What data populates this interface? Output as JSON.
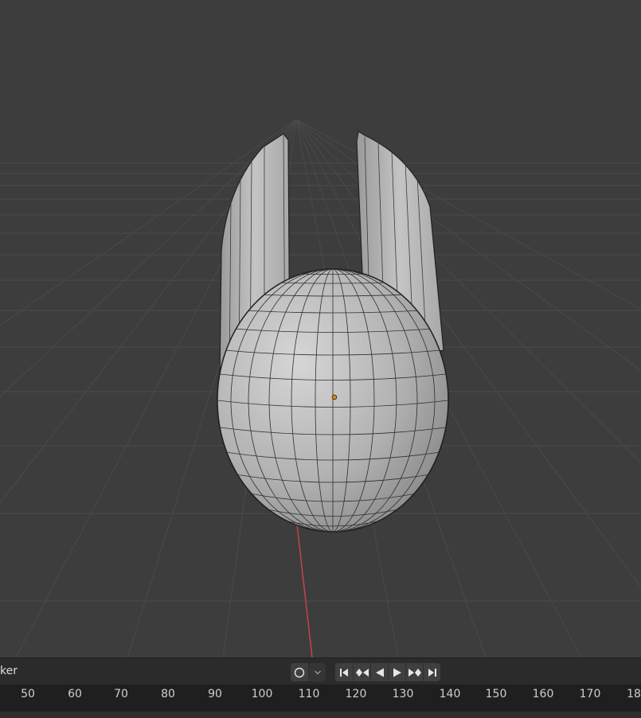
{
  "timeline": {
    "marker_label": "ker",
    "controls": [
      {
        "name": "keying-toggle",
        "icon": "circle-icon"
      },
      {
        "name": "keying-dropdown",
        "icon": "chevron-down-icon"
      },
      {
        "name": "jump-to-start",
        "icon": "jump-start-icon"
      },
      {
        "name": "prev-keyframe",
        "icon": "prev-keyframe-icon"
      },
      {
        "name": "play-reverse",
        "icon": "play-reverse-icon"
      },
      {
        "name": "play",
        "icon": "play-icon"
      },
      {
        "name": "next-keyframe",
        "icon": "next-keyframe-icon"
      },
      {
        "name": "jump-to-end",
        "icon": "jump-end-icon"
      }
    ],
    "ruler_ticks": [
      "50",
      "60",
      "70",
      "80",
      "90",
      "100",
      "110",
      "120",
      "130",
      "140",
      "150",
      "160",
      "170",
      "18"
    ]
  },
  "colors": {
    "viewport_bg": "#3d3d3d",
    "grid_line": "#4a4a4a",
    "x_axis": "#c8424d",
    "mesh_fill": "#b8b8b8",
    "origin": "#e08a1e"
  }
}
